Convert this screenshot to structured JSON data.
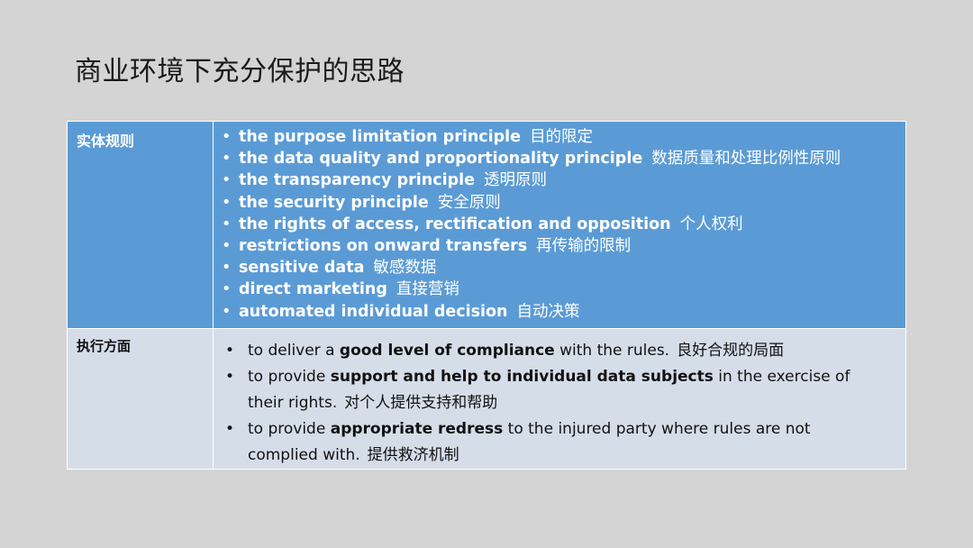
{
  "title": "商业环境下充分保护的思路",
  "rows": [
    {
      "label": "实体规则",
      "items": [
        {
          "en": "the purpose limitation principle",
          "zh": "目的限定"
        },
        {
          "en": "the data quality and proportionality principle",
          "zh": "数据质量和处理比例性原则"
        },
        {
          "en": "the transparency principle",
          "zh": "透明原则"
        },
        {
          "en": "the security principle",
          "zh": "安全原则"
        },
        {
          "en": "the rights of access, rectification and opposition",
          "zh": "个人权利"
        },
        {
          "en": "restrictions on onward transfers",
          "zh": "再传输的限制"
        },
        {
          "en": "sensitive data",
          "zh": "敏感数据"
        },
        {
          "en": "direct marketing",
          "zh": "直接营销"
        },
        {
          "en": "automated individual decision",
          "zh": "自动决策"
        }
      ]
    },
    {
      "label": "执行方面",
      "items": [
        {
          "pre": "to deliver a ",
          "bold": "good level of compliance",
          "post": " with the rules.",
          "zh": "良好合规的局面"
        },
        {
          "pre": "to provide ",
          "bold": "support and help to individual data subjects",
          "post": " in the exercise of their rights.",
          "zh": "对个人提供支持和帮助"
        },
        {
          "pre": "to provide ",
          "bold": "appropriate redress",
          "post": " to the injured party where rules are not complied with.",
          "zh": "提供救济机制"
        }
      ]
    }
  ],
  "bullet": "•"
}
